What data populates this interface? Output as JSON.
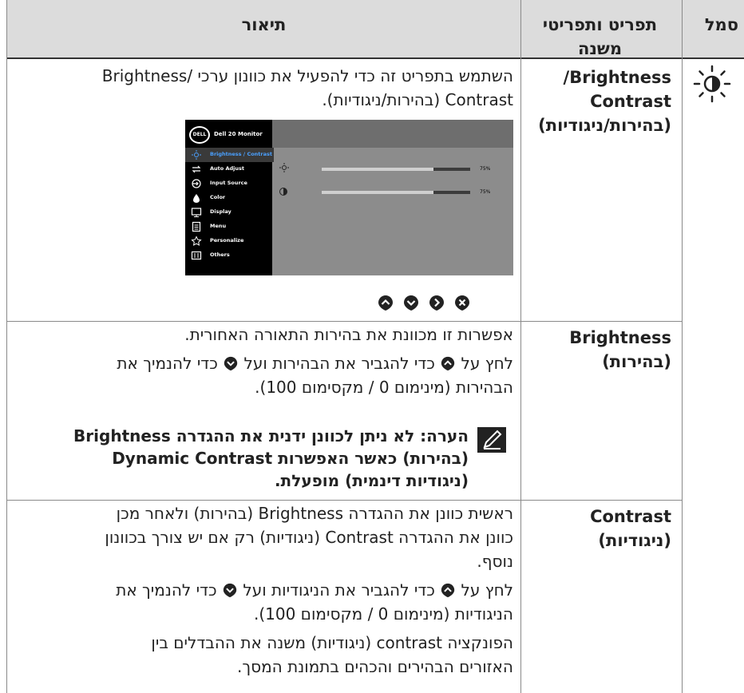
{
  "header": {
    "col_symbol": "סמל",
    "col_menu": "תפריט ותפריטי משנה",
    "col_desc": "תיאור"
  },
  "rows": [
    {
      "symbol_icon": "brightness-sun-icon",
      "menu": [
        "Brightness/",
        "Contrast",
        "(בהירות/ניגודיות)"
      ],
      "desc": [
        "השתמש בתפריט זה כדי להפעיל את כוונון ערכי /Brightness",
        "Contrast (בהירות/ניגודיות)."
      ]
    },
    {
      "menu": [
        "Brightness",
        "(בהירות)"
      ],
      "desc_line1": "אפשרות זו מכוונת את בהירות התאורה האחורית.",
      "press_a": "לחץ על",
      "press_b": "כדי להגביר את הבהירות ועל",
      "press_c": "כדי להנמיך את",
      "press_line2": "הבהירות (מינימום 0 / מקסימום 100).",
      "note": [
        "הערה: לא ניתן לכוונן ידנית את ההגדרה Brightness",
        "(בהירות) כאשר האפשרות Dynamic Contrast",
        "(ניגודיות דינמית) מופעלת."
      ]
    },
    {
      "menu": [
        "Contrast",
        "(ניגודיות)"
      ],
      "desc": [
        "ראשית כוונן את ההגדרה Brightness (בהירות) ולאחר מכן",
        "כוונן את ההגדרה Contrast (ניגודיות) רק אם יש צורך בכוונון",
        "נוסף."
      ],
      "press_a": "לחץ על",
      "press_b": "כדי להגביר את הניגודיות ועל",
      "press_c": "כדי להנמיך את",
      "press_line2": "הניגודיות (מינימום 0 / מקסימום 100).",
      "desc_end": [
        "הפונקציה contrast (ניגודיות) משנה את ההבדלים בין",
        "האזורים הבהירים והכהים בתמונת המסך."
      ]
    }
  ],
  "osd": {
    "logo": "DELL",
    "title": "Dell 20 Monitor",
    "items": [
      "Brightness / Contrast",
      "Auto Adjust",
      "Input Source",
      "Color",
      "Display",
      "Menu",
      "Personalize",
      "Others"
    ],
    "brightness_pct_label": "75%",
    "contrast_pct_label": "75%",
    "brightness_level": 0.75,
    "contrast_level": 0.75
  },
  "nav_buttons": [
    "up-arrow-icon",
    "down-arrow-icon",
    "right-arrow-icon",
    "close-icon"
  ],
  "colors": {
    "header_bg": "#dcdcdc",
    "osd_bg": "#8c8c8c",
    "osd_selected": "#4aa0ff"
  }
}
